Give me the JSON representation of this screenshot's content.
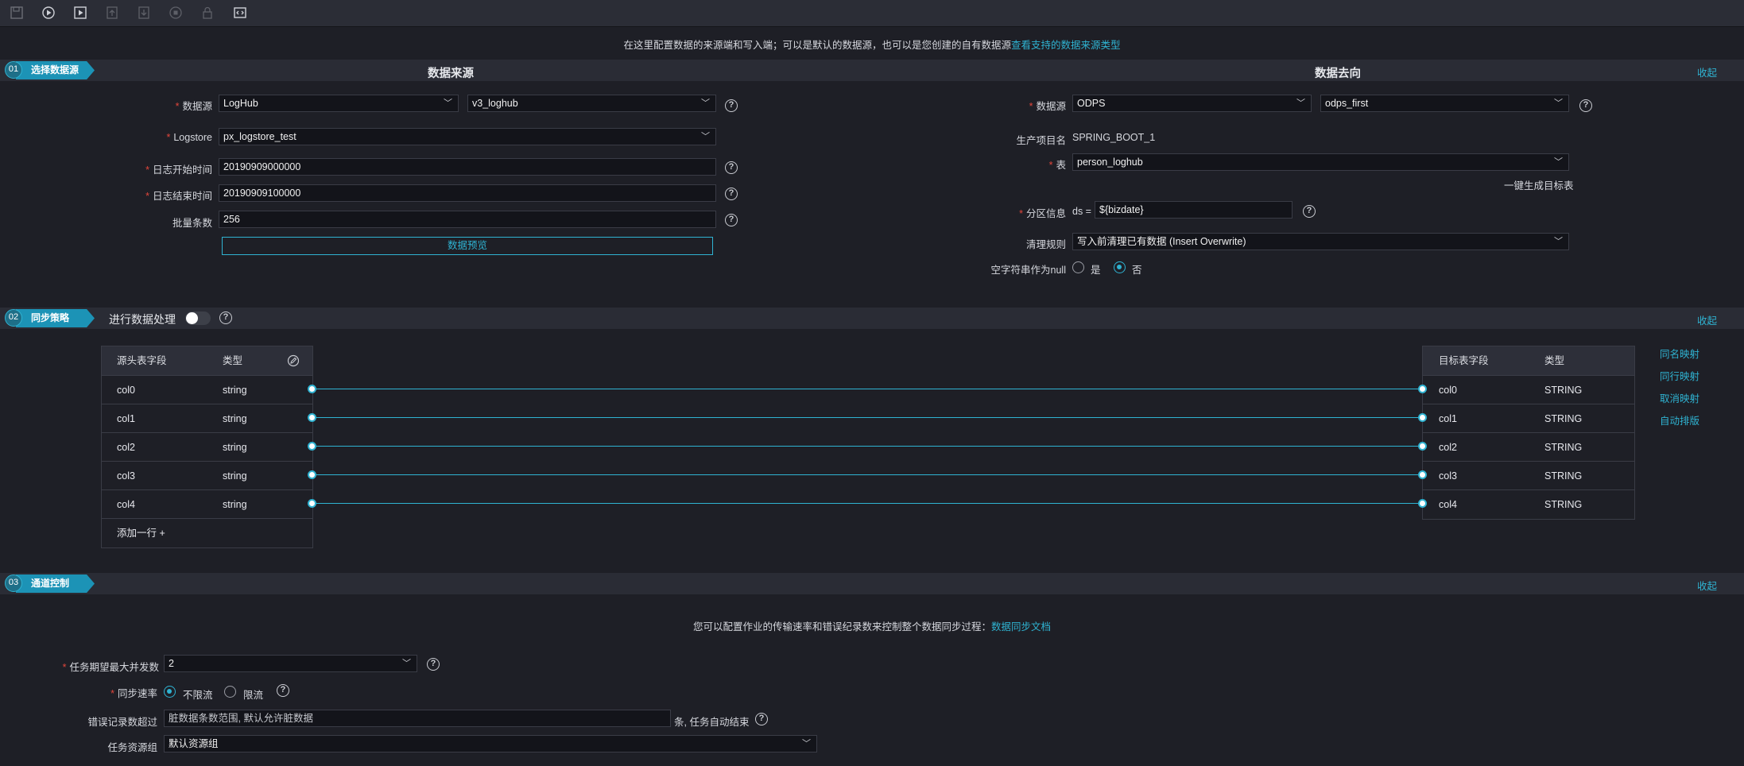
{
  "toolbar": {
    "icons": [
      "save-icon",
      "run-icon",
      "run-with-params-icon",
      "submit-icon",
      "publish-icon",
      "stop-icon",
      "lock-icon",
      "code-view-icon"
    ]
  },
  "hint_top": {
    "text": "在这里配置数据的来源端和写入端；可以是默认的数据源，也可以是您创建的自有数据源",
    "link": "查看支持的数据来源类型"
  },
  "section1": {
    "num": "01",
    "label": "选择数据源",
    "collapse": "收起",
    "source_title": "数据来源",
    "target_title": "数据去向",
    "source": {
      "datasource_label": "数据源",
      "datasource_type": "LogHub",
      "datasource_name": "v3_loghub",
      "logstore_label": "Logstore",
      "logstore_value": "px_logstore_test",
      "start_label": "日志开始时间",
      "start_value": "20190909000000",
      "end_label": "日志结束时间",
      "end_value": "20190909100000",
      "batch_label": "批量条数",
      "batch_value": "256",
      "preview_button": "数据预览"
    },
    "target": {
      "datasource_label": "数据源",
      "datasource_type": "ODPS",
      "datasource_name": "odps_first",
      "project_label": "生产项目名",
      "project_value": "SPRING_BOOT_1",
      "table_label": "表",
      "table_value": "person_loghub",
      "gen_table_link": "一键生成目标表",
      "partition_label": "分区信息",
      "partition_prefix": "ds =",
      "partition_value": "${bizdate}",
      "clean_label": "清理规则",
      "clean_value": "写入前清理已有数据 (Insert Overwrite)",
      "null_label": "空字符串作为null",
      "null_yes": "是",
      "null_no": "否",
      "null_selected": "否"
    }
  },
  "section2": {
    "num": "02",
    "label": "同步策略",
    "collapse": "收起",
    "processing_label": "进行数据处理",
    "processing_on": false,
    "source_table": {
      "headers": [
        "源头表字段",
        "类型"
      ],
      "rows": [
        [
          "col0",
          "string"
        ],
        [
          "col1",
          "string"
        ],
        [
          "col2",
          "string"
        ],
        [
          "col3",
          "string"
        ],
        [
          "col4",
          "string"
        ]
      ],
      "add_row": "添加一行 +"
    },
    "target_table": {
      "headers": [
        "目标表字段",
        "类型"
      ],
      "rows": [
        [
          "col0",
          "STRING"
        ],
        [
          "col1",
          "STRING"
        ],
        [
          "col2",
          "STRING"
        ],
        [
          "col3",
          "STRING"
        ],
        [
          "col4",
          "STRING"
        ]
      ]
    },
    "mapping_actions": [
      "同名映射",
      "同行映射",
      "取消映射",
      "自动排版"
    ]
  },
  "section3": {
    "num": "03",
    "label": "通道控制",
    "collapse": "收起",
    "hint": "您可以配置作业的传输速率和错误纪录数来控制整个数据同步过程：",
    "hint_link": "数据同步文档",
    "concurrency_label": "任务期望最大并发数",
    "concurrency_value": "2",
    "rate_label": "同步速率",
    "rate_unlimited": "不限流",
    "rate_limited": "限流",
    "rate_selected": "不限流",
    "error_label": "错误记录数超过",
    "error_placeholder": "脏数据条数范围, 默认允许脏数据",
    "error_suffix": "条, 任务自动结束",
    "resource_label": "任务资源组",
    "resource_value": "默认资源组"
  },
  "colors": {
    "accent": "#2fb3d2",
    "background": "#1e1f26",
    "band": "#2a2c35",
    "required": "#e2463b"
  }
}
